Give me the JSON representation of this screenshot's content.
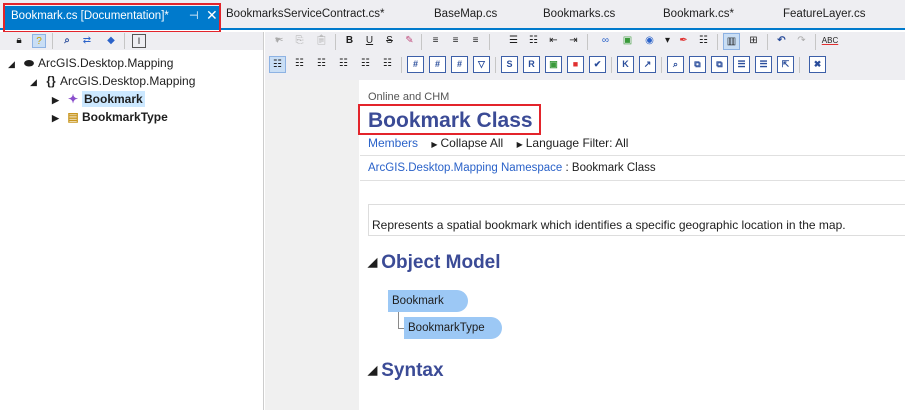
{
  "tabs": [
    {
      "label": "Bookmark.cs [Documentation]*",
      "active": true
    },
    {
      "label": "BookmarksServiceContract.cs*"
    },
    {
      "label": "BaseMap.cs"
    },
    {
      "label": "Bookmarks.cs"
    },
    {
      "label": "Bookmark.cs*"
    },
    {
      "label": "FeatureLayer.cs"
    }
  ],
  "active_tab_icons": {
    "pin": "pin-icon",
    "close": "close-icon"
  },
  "left_toolbar": {
    "icons": [
      "lock-icon",
      "help-icon",
      "search-icon",
      "sync-icon",
      "diamond-icon",
      "text-icon"
    ]
  },
  "tree": {
    "root": "ArcGIS.Desktop.Mapping",
    "namespace_brace": "{}",
    "namespace": "ArcGIS.Desktop.Mapping",
    "children": [
      {
        "label": "Bookmark",
        "selected": true
      },
      {
        "label": "BookmarkType"
      }
    ]
  },
  "toolbar_row1_icons": [
    "cut-icon",
    "copy-icon",
    "paste-icon",
    "bold-icon",
    "underline-icon",
    "strikethrough-icon",
    "eraser-icon",
    "align-left-icon",
    "align-center-icon",
    "align-right-icon",
    "bullet-list-icon",
    "numbered-list-icon",
    "outdent-icon",
    "indent-icon",
    "link-icon",
    "image-icon",
    "bookmark-icon",
    "dropdown-icon",
    "highlight-icon",
    "spellcheck-block-icon",
    "view-icon",
    "table-icon",
    "undo-icon",
    "redo-icon",
    "spellcheck-icon"
  ],
  "toolbar_row1_glyphs": {
    "bold": "B",
    "underline": "U",
    "strike": "S",
    "spell": "ABC"
  },
  "toolbar_row2_glyphs": [
    "#",
    "#",
    "#",
    "S",
    "R",
    "K"
  ],
  "doc": {
    "header": "Online and CHM",
    "title": "Bookmark Class",
    "members_link": "Members",
    "collapse_all": "Collapse All",
    "language_filter": "Language Filter: All",
    "ns_link": "ArcGIS.Desktop.Mapping Namespace",
    "ns_suffix": " : Bookmark Class",
    "description": "Represents a spatial bookmark which identifies a specific geographic location in the map.",
    "section_object_model": "Object Model",
    "section_syntax": "Syntax",
    "object_model_nodes": [
      "Bookmark",
      "BookmarkType"
    ]
  },
  "colors": {
    "accent": "#007acc",
    "title": "#3b4b96",
    "link": "#2a62c9",
    "highlight_box": "#e3242b",
    "om_node": "#9cc8f5"
  }
}
